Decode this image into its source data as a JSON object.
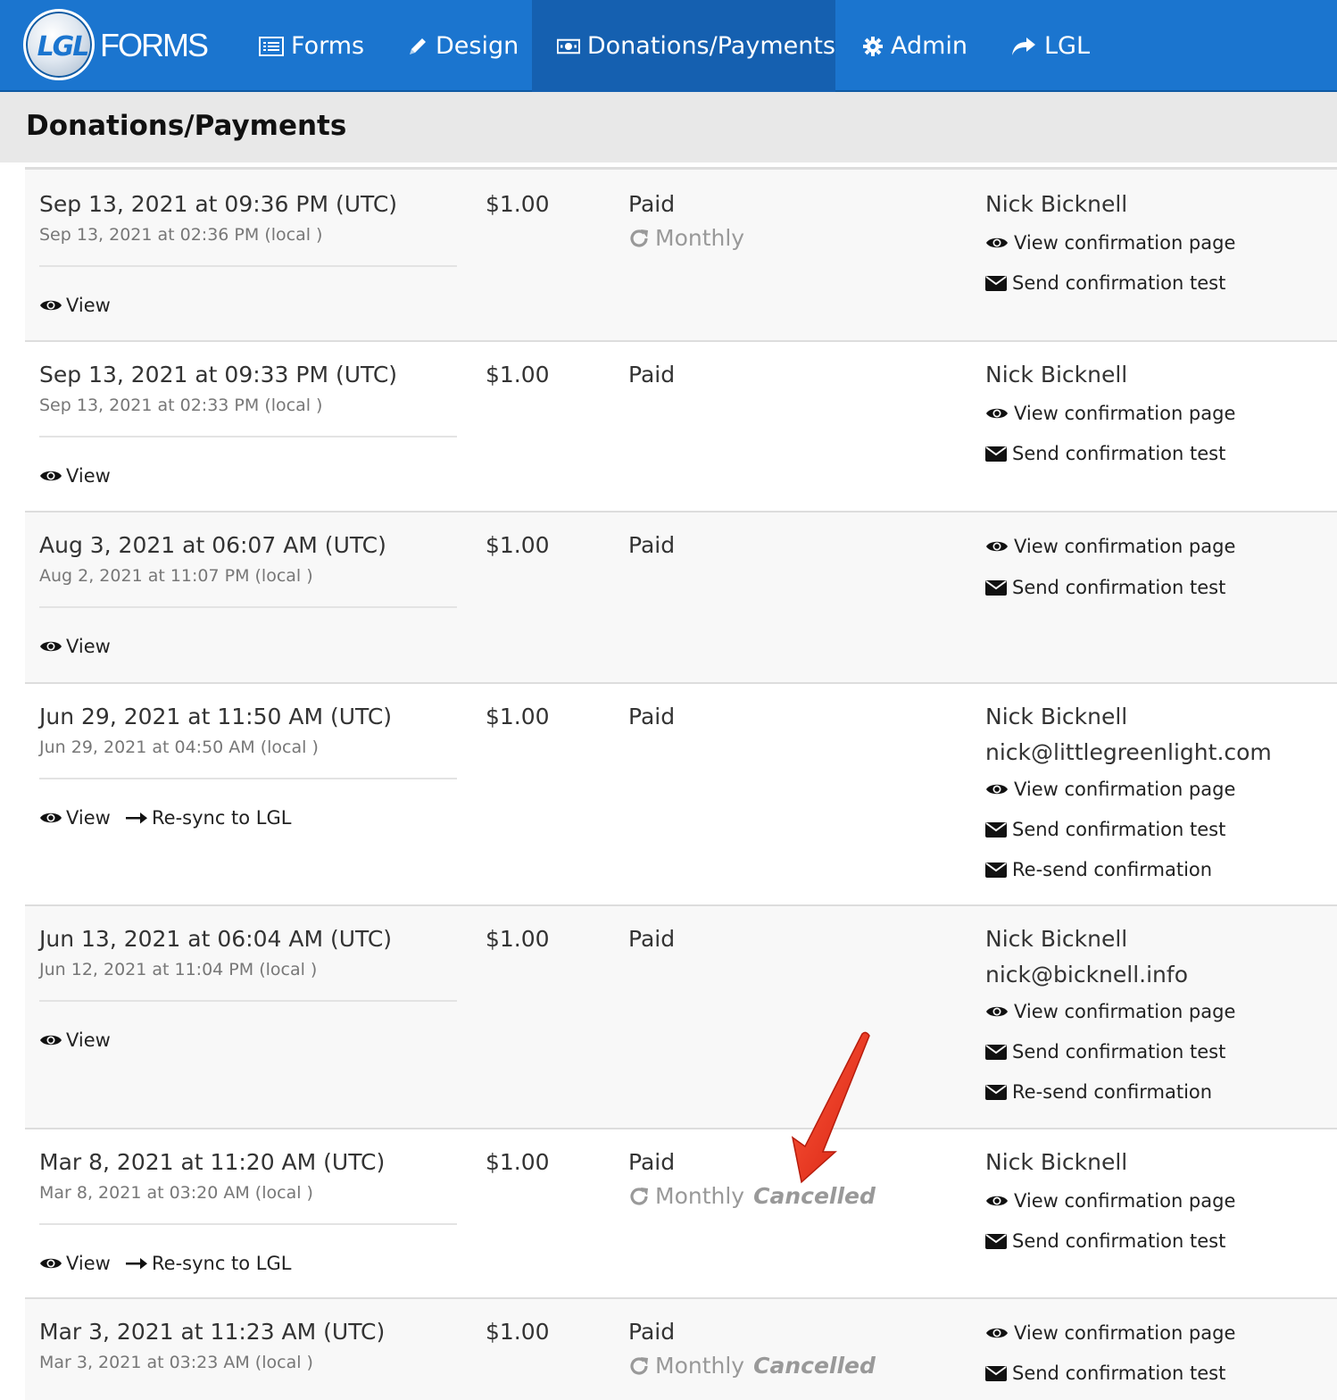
{
  "brand": {
    "logo_mark": "LGL",
    "logo_word": "FORMS"
  },
  "nav": {
    "forms": "Forms",
    "design": "Design",
    "donations": "Donations/Payments",
    "admin": "Admin",
    "lgl": "LGL"
  },
  "page": {
    "title": "Donations/Payments"
  },
  "actions": {
    "view": "View",
    "resync": "Re-sync to LGL",
    "view_confirmation": "View confirmation page",
    "send_test": "Send confirmation test",
    "resend": "Re-send confirmation"
  },
  "rows": [
    {
      "utc": "Sep 13, 2021 at 09:36 PM (UTC)",
      "local": "Sep 13, 2021 at 02:36 PM (local )",
      "amount": "$1.00",
      "status": "Paid",
      "recurring": "Monthly",
      "recurring_status": "",
      "name": "Nick Bicknell",
      "email": ""
    },
    {
      "utc": "Sep 13, 2021 at 09:33 PM (UTC)",
      "local": "Sep 13, 2021 at 02:33 PM (local )",
      "amount": "$1.00",
      "status": "Paid",
      "recurring": "",
      "recurring_status": "",
      "name": "Nick Bicknell",
      "email": ""
    },
    {
      "utc": "Aug 3, 2021 at 06:07 AM (UTC)",
      "local": "Aug 2, 2021 at 11:07 PM (local )",
      "amount": "$1.00",
      "status": "Paid",
      "recurring": "",
      "recurring_status": "",
      "name": "",
      "email": ""
    },
    {
      "utc": "Jun 29, 2021 at 11:50 AM (UTC)",
      "local": "Jun 29, 2021 at 04:50 AM (local )",
      "amount": "$1.00",
      "status": "Paid",
      "recurring": "",
      "recurring_status": "",
      "name": "Nick Bicknell",
      "email": "nick@littlegreenlight.com"
    },
    {
      "utc": "Jun 13, 2021 at 06:04 AM (UTC)",
      "local": "Jun 12, 2021 at 11:04 PM (local )",
      "amount": "$1.00",
      "status": "Paid",
      "recurring": "",
      "recurring_status": "",
      "name": "Nick Bicknell",
      "email": "nick@bicknell.info"
    },
    {
      "utc": "Mar 8, 2021 at 11:20 AM (UTC)",
      "local": "Mar 8, 2021 at 03:20 AM (local )",
      "amount": "$1.00",
      "status": "Paid",
      "recurring": "Monthly",
      "recurring_status": "Cancelled",
      "name": "Nick Bicknell",
      "email": ""
    },
    {
      "utc": "Mar 3, 2021 at 11:23 AM (UTC)",
      "local": "Mar 3, 2021 at 03:23 AM (local )",
      "amount": "$1.00",
      "status": "Paid",
      "recurring": "Monthly",
      "recurring_status": "Cancelled",
      "name": "",
      "email": ""
    }
  ],
  "colors": {
    "navbar": "#1b75cf",
    "navbar_active": "#1560b0",
    "annotation_arrow": "#e8311f"
  }
}
